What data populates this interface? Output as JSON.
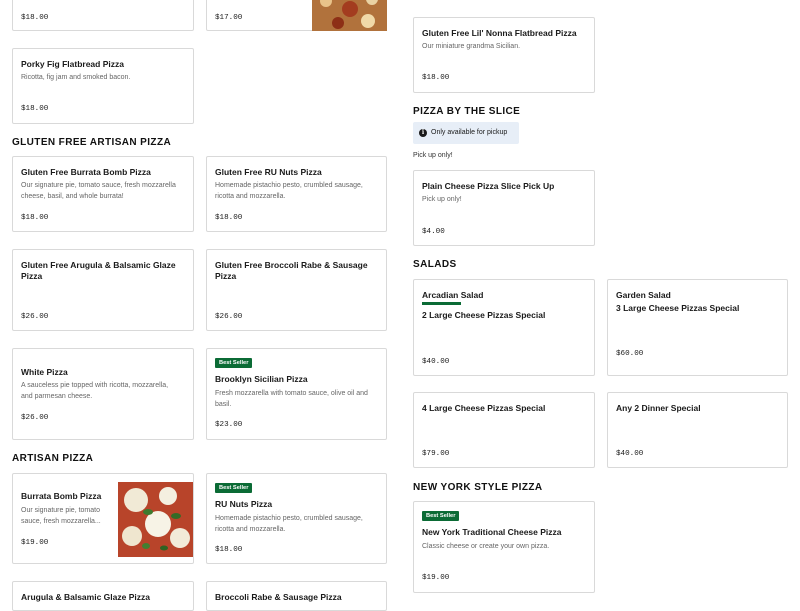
{
  "sections": {
    "gf_artisan": "GLUTEN FREE ARTISAN PIZZA",
    "artisan": "ARTISAN PIZZA",
    "by_slice": "PIZZA BY THE SLICE",
    "salads": "SALADS",
    "ny_style": "NEW YORK STYLE PIZZA"
  },
  "slice_notice": {
    "text": "Only available for pickup",
    "icon": "info-icon"
  },
  "slice_pickup_text": "Pick up only!",
  "badge_label": "Best Seller",
  "items": {
    "top_left": {
      "price": "$18.00"
    },
    "top_mid": {
      "price": "$17.00"
    },
    "porky_fig": {
      "name": "Porky Fig Flatbread Pizza",
      "desc": "Ricotta, fig jam and smoked bacon.",
      "price": "$18.00"
    },
    "gf_lil_nonna": {
      "name": "Gluten Free Lil' Nonna Flatbread Pizza",
      "desc": "Our miniature grandma Sicilian.",
      "price": "$18.00"
    },
    "gf_burrata": {
      "name": "Gluten Free Burrata Bomb Pizza",
      "desc1": "Our signature pie, tomato sauce, fresh mozzarella",
      "desc2": "cheese, basil, and whole burrata!",
      "price": "$18.00"
    },
    "gf_ru_nuts": {
      "name": "Gluten Free RU Nuts Pizza",
      "desc1": "Homemade pistachio pesto, crumbled sausage,",
      "desc2": "ricotta and mozzarella.",
      "price": "$18.00"
    },
    "plain_slice": {
      "name": "Plain Cheese Pizza Slice Pick Up",
      "desc": "Pick up only!",
      "price": "$4.00"
    },
    "gf_arugula": {
      "name": "Gluten Free Arugula & Balsamic Glaze Pizza",
      "price": "$26.00"
    },
    "gf_broccoli": {
      "name": "Gluten Free Broccoli Rabe & Sausage Pizza",
      "price": "$26.00"
    },
    "arcadian_salad": {
      "name": "Arcadian Salad",
      "special": "2 Large Cheese Pizzas Special",
      "price": "$40.00"
    },
    "garden_salad": {
      "name": "Garden Salad",
      "special": "3 Large Cheese Pizzas Special",
      "price": "$60.00"
    },
    "white_pizza": {
      "name": "White Pizza",
      "desc1": "A sauceless pie topped with ricotta, mozzarella,",
      "desc2": "and parmesan cheese.",
      "price": "$26.00"
    },
    "brooklyn_sicilian": {
      "name": "Brooklyn Sicilian Pizza",
      "desc1": "Fresh mozzarella with tomato sauce, olive oil and",
      "desc2": "basil.",
      "price": "$23.00"
    },
    "four_large": {
      "name": "4 Large Cheese Pizzas Special",
      "price": "$79.00"
    },
    "any_two_dinner": {
      "name": "Any 2 Dinner Special",
      "price": "$40.00"
    },
    "burrata_bomb": {
      "name": "Burrata Bomb Pizza",
      "desc1": "Our signature pie, tomato",
      "desc2": "sauce, fresh mozzarella...",
      "price": "$19.00"
    },
    "ru_nuts": {
      "name": "RU Nuts Pizza",
      "desc1": "Homemade pistachio pesto, crumbled sausage,",
      "desc2": "ricotta and mozzarella.",
      "price": "$18.00"
    },
    "ny_traditional": {
      "name": "New York Traditional Cheese Pizza",
      "desc": "Classic cheese or create your own pizza.",
      "price": "$19.00"
    },
    "arugula_balsamic": {
      "name": "Arugula & Balsamic Glaze Pizza"
    },
    "broccoli_rabe": {
      "name": "Broccoli Rabe & Sausage Pizza"
    }
  },
  "colors": {
    "badge": "#0b6b35",
    "notice_bg": "#e7eef7",
    "border": "#d9d9d9"
  }
}
